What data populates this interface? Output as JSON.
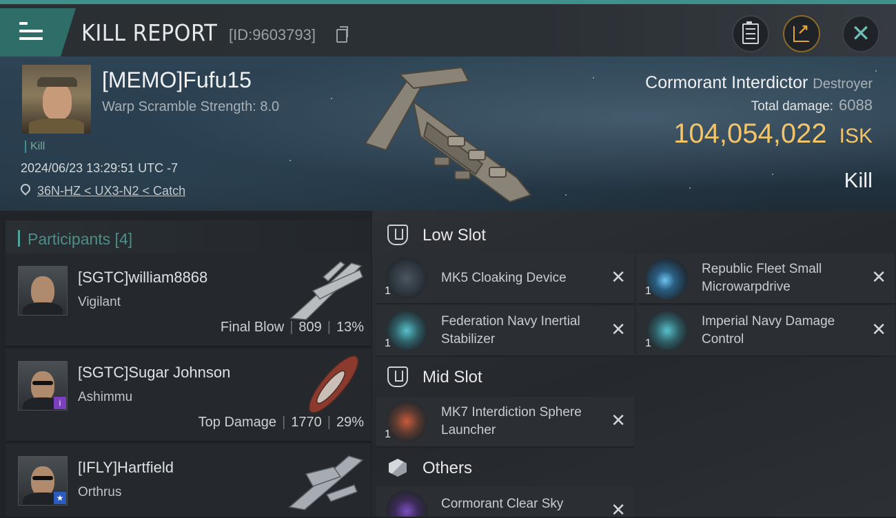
{
  "header": {
    "title": "KILL REPORT",
    "report_id": "[ID:9603793]"
  },
  "victim": {
    "name": "[MEMO]Fufu15",
    "detail": "Warp Scramble Strength: 8.0",
    "tag": "Kill",
    "datetime": "2024/06/23 13:29:51 UTC -7",
    "location": "36N-HZ < UX3-N2 < Catch",
    "ship_name": "Cormorant Interdictor",
    "ship_class": "Destroyer",
    "total_damage_label": "Total damage:",
    "total_damage": "6088",
    "isk_value": "104,054,022",
    "isk_unit": "ISK",
    "result": "Kill"
  },
  "participants": {
    "heading": "Participants [4]",
    "items": [
      {
        "name": "[SGTC]william8868",
        "ship": "Vigilant",
        "stat_label": "Final Blow",
        "damage": "809",
        "percent": "13%",
        "badge": ""
      },
      {
        "name": "[SGTC]Sugar Johnson",
        "ship": "Ashimmu",
        "stat_label": "Top Damage",
        "damage": "1770",
        "percent": "29%",
        "badge": "i"
      },
      {
        "name": "[IFLY]Hartfield",
        "ship": "Orthrus",
        "stat_label": "",
        "damage": "",
        "percent": "",
        "badge": "★"
      }
    ]
  },
  "fitting": {
    "low_slot": {
      "label": "Low Slot",
      "modules": [
        {
          "name": "MK5 Cloaking Device",
          "qty": "1"
        },
        {
          "name": "Republic Fleet Small Microwarpdrive",
          "qty": "1"
        },
        {
          "name": "Federation Navy Inertial Stabilizer",
          "qty": "1"
        },
        {
          "name": "Imperial Navy Damage Control",
          "qty": "1"
        }
      ]
    },
    "mid_slot": {
      "label": "Mid Slot",
      "modules": [
        {
          "name": "MK7 Interdiction Sphere Launcher",
          "qty": "1"
        }
      ]
    },
    "others": {
      "label": "Others",
      "modules": [
        {
          "name": "Cormorant Clear Sky",
          "qty": ""
        }
      ]
    },
    "remove_glyph": "✕"
  },
  "icons": {
    "menu": "hamburger-menu-icon",
    "copy": "copy-icon",
    "clipboard": "clipboard-icon",
    "share": "share-icon",
    "close": "close-icon",
    "location": "location-pin-icon"
  },
  "colors": {
    "accent": "#3f8f8a",
    "isk": "#f2c56a",
    "participants_heading": "#4d8e87"
  }
}
